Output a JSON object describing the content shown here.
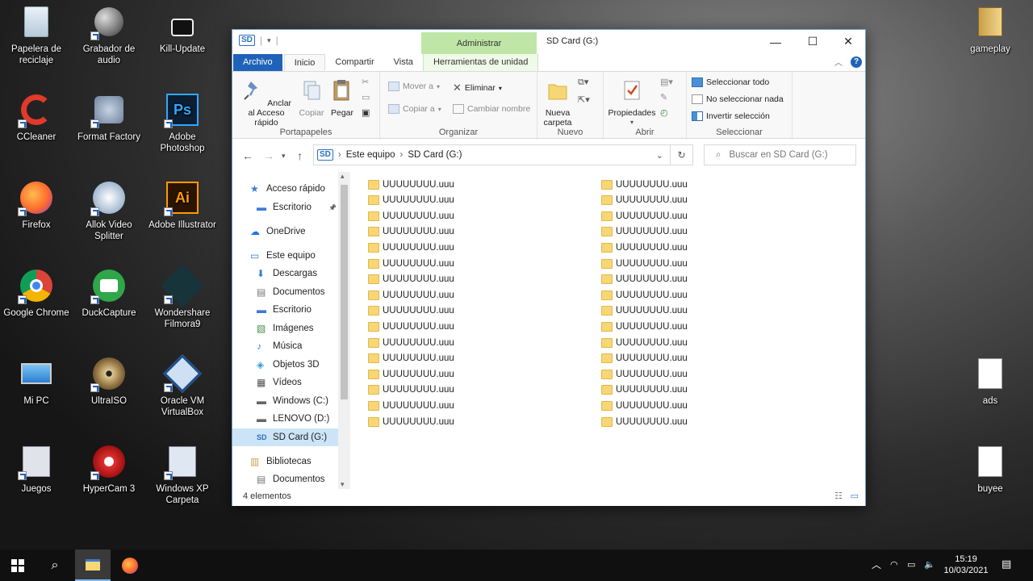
{
  "desktop": {
    "icons_left": [
      {
        "label": "Papelera de reciclaje",
        "icon": "recycle-bin-icon"
      },
      {
        "label": "Grabador de audio",
        "icon": "microphone-icon"
      },
      {
        "label": "Kill-Update",
        "icon": "lock-icon"
      },
      {
        "label": "CCleaner",
        "icon": "ccleaner-icon"
      },
      {
        "label": "Format Factory",
        "icon": "format-factory-icon"
      },
      {
        "label": "Adobe Photoshop",
        "icon": "photoshop-icon"
      },
      {
        "label": "Firefox",
        "icon": "firefox-icon"
      },
      {
        "label": "Allok Video Splitter",
        "icon": "video-splitter-icon"
      },
      {
        "label": "Adobe Illustrator",
        "icon": "illustrator-icon"
      },
      {
        "label": "Google Chrome",
        "icon": "chrome-icon"
      },
      {
        "label": "DuckCapture",
        "icon": "camera-icon"
      },
      {
        "label": "Wondershare Filmora9",
        "icon": "filmora-icon"
      },
      {
        "label": "Mi PC",
        "icon": "computer-icon"
      },
      {
        "label": "UltraISO",
        "icon": "disc-icon"
      },
      {
        "label": "Oracle VM VirtualBox",
        "icon": "virtualbox-icon"
      },
      {
        "label": "Juegos",
        "icon": "games-icon"
      },
      {
        "label": "HyperCam 3",
        "icon": "hypercam-icon"
      },
      {
        "label": "Windows XP Carpeta",
        "icon": "windows-xp-icon"
      }
    ],
    "icons_right": [
      {
        "label": "gameplay",
        "icon": "folder-icon"
      },
      {
        "label": "ads",
        "icon": "document-icon"
      },
      {
        "label": "buyee",
        "icon": "document-icon"
      }
    ]
  },
  "window": {
    "title": "SD Card (G:)",
    "context_tab_header": "Administrar",
    "controls": {
      "minimize": "—",
      "maximize": "☐",
      "close": "✕"
    },
    "tabs": [
      "Archivo",
      "Inicio",
      "Compartir",
      "Vista",
      "Herramientas de unidad"
    ],
    "ribbon": {
      "portapapeles": {
        "label": "Portapapeles",
        "pin": "Anclar al Acceso rápido",
        "copy": "Copiar",
        "paste": "Pegar"
      },
      "organizar": {
        "label": "Organizar",
        "move": "Mover a",
        "copy_to": "Copiar a",
        "delete": "Eliminar",
        "rename": "Cambiar nombre"
      },
      "nuevo": {
        "label": "Nuevo",
        "new_folder": "Nueva carpeta"
      },
      "abrir": {
        "label": "Abrir",
        "properties": "Propiedades"
      },
      "seleccionar": {
        "label": "Seleccionar",
        "select_all": "Seleccionar todo",
        "select_none": "No seleccionar nada",
        "invert": "Invertir selección"
      }
    },
    "address": {
      "segments": [
        "Este equipo",
        "SD Card (G:)"
      ]
    },
    "search_placeholder": "Buscar en SD Card (G:)",
    "nav": [
      {
        "label": "Acceso rápido",
        "icon": "star-icon",
        "indent": 0
      },
      {
        "label": "Escritorio",
        "icon": "desktop-icon",
        "indent": 1
      },
      {
        "label": "OneDrive",
        "icon": "cloud-icon",
        "indent": 0
      },
      {
        "label": "Este equipo",
        "icon": "computer-icon",
        "indent": 0
      },
      {
        "label": "Descargas",
        "icon": "download-icon",
        "indent": 1
      },
      {
        "label": "Documentos",
        "icon": "documents-icon",
        "indent": 1
      },
      {
        "label": "Escritorio",
        "icon": "desktop-icon",
        "indent": 1
      },
      {
        "label": "Imágenes",
        "icon": "pictures-icon",
        "indent": 1
      },
      {
        "label": "Música",
        "icon": "music-icon",
        "indent": 1
      },
      {
        "label": "Objetos 3D",
        "icon": "cube-icon",
        "indent": 1
      },
      {
        "label": "Vídeos",
        "icon": "video-icon",
        "indent": 1
      },
      {
        "label": "Windows (C:)",
        "icon": "drive-icon",
        "indent": 1
      },
      {
        "label": "LENOVO (D:)",
        "icon": "drive-icon",
        "indent": 1
      },
      {
        "label": "SD Card (G:)",
        "icon": "sd-card-icon",
        "indent": 1,
        "selected": true
      },
      {
        "label": "Bibliotecas",
        "icon": "library-icon",
        "indent": 0
      },
      {
        "label": "Documentos",
        "icon": "documents-icon",
        "indent": 1
      }
    ],
    "files_col1": [
      "UUUUUUUU.uuu",
      "UUUUUUUU.uuu",
      "UUUUUUUU.uuu",
      "UUUUUUUU.uuu",
      "UUUUUUUU.uuu",
      "UUUUUUUU.uuu",
      "UUUUUUUU.uuu",
      "UUUUUUUU.uuu",
      "UUUUUUUU.uuu",
      "UUUUUUUU.uuu",
      "UUUUUUUU.uuu",
      "UUUUUUUU.uuu",
      "UUUUUUUU.uuu",
      "UUUUUUUU.uuu",
      "UUUUUUUU.uuu",
      "UUUUUUUU.uuu"
    ],
    "files_col2": [
      "UUUUUUUU.uuu",
      "UUUUUUUU.uuu",
      "UUUUUUUU.uuu",
      "UUUUUUUU.uuu",
      "UUUUUUUU.uuu",
      "UUUUUUUU.uuu",
      "UUUUUUUU.uuu",
      "UUUUUUUU.uuu",
      "UUUUUUUU.uuu",
      "UUUUUUUU.uuu",
      "UUUUUUUU.uuu",
      "UUUUUUUU.uuu",
      "UUUUUUUU.uuu",
      "UUUUUUUU.uuu",
      "UUUUUUUU.uuu",
      "UUUUUUUU.uuu"
    ],
    "status": "4 elementos"
  },
  "taskbar": {
    "time": "15:19",
    "date": "10/03/2021"
  },
  "colors": {
    "accent": "#1f63b8",
    "context_tab": "#bfe6a6",
    "selected_nav": "#cce4f7",
    "folder": "#f7d675"
  }
}
